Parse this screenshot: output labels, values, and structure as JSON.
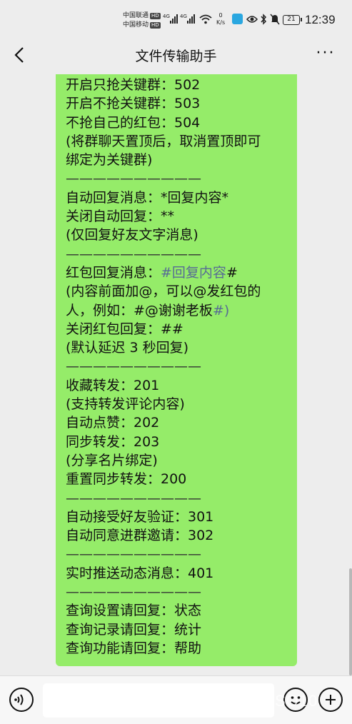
{
  "status_bar": {
    "carrier1": "中国联通",
    "carrier1_badge": "HD",
    "carrier2": "中国移动",
    "carrier2_badge": "HD",
    "signal1_label": "4G",
    "signal2_label": "4G",
    "net_speed_value": "0",
    "net_speed_unit": "K/s",
    "battery": "21",
    "time": "12:39",
    "icons": [
      "wifi-icon",
      "app-notification-icon",
      "eye-icon",
      "bluetooth-icon",
      "mute-icon",
      "battery-icon"
    ]
  },
  "nav": {
    "title": "文件传输助手",
    "back_icon": "chevron-left-icon",
    "more_icon": "more-dots-icon",
    "more_label": "···"
  },
  "chat": {
    "bubble_color": "#95ec69",
    "message_lines": [
      {
        "text": "开启只抢关键群：502"
      },
      {
        "text": "开启不抢关键群：503"
      },
      {
        "text": "不抢自己的红包：504"
      },
      {
        "text": "(将群聊天置顶后，取消置顶即可"
      },
      {
        "text": "绑定为关键群)"
      },
      {
        "text": "——————————",
        "sep": true
      },
      {
        "text": "自动回复消息：*回复内容*"
      },
      {
        "text": "关闭自动回复：**"
      },
      {
        "text": "(仅回复好友文字消息)"
      },
      {
        "text": "——————————",
        "sep": true
      },
      {
        "pre": "红包回复消息：",
        "link": "#回复内容",
        "post": "#"
      },
      {
        "text": "(内容前面加@，可以@发红包的"
      },
      {
        "pre": "人，例如：#@谢谢老板",
        "link": "#)",
        "post": ""
      },
      {
        "text": "关闭红包回复：##"
      },
      {
        "text": "(默认延迟 3 秒回复)"
      },
      {
        "text": "——————————",
        "sep": true
      },
      {
        "text": "收藏转发：201"
      },
      {
        "text": "(支持转发评论内容)"
      },
      {
        "text": "自动点赞：202"
      },
      {
        "text": "同步转发：203"
      },
      {
        "text": "(分享名片绑定)"
      },
      {
        "text": "重置同步转发：200"
      },
      {
        "text": "——————————",
        "sep": true
      },
      {
        "text": "自动接受好友验证：301"
      },
      {
        "text": "自动同意进群邀请：302"
      },
      {
        "text": "——————————",
        "sep": true
      },
      {
        "text": "实时推送动态消息：401"
      },
      {
        "text": "——————————",
        "sep": true
      },
      {
        "text": "查询设置请回复：状态"
      },
      {
        "text": "查询记录请回复：统计"
      },
      {
        "text": "查询功能请回复：帮助"
      }
    ]
  },
  "input_bar": {
    "voice_icon": "voice-icon",
    "emoji_icon": "emoji-icon",
    "plus_icon": "plus-icon",
    "watermark": "SO10"
  }
}
